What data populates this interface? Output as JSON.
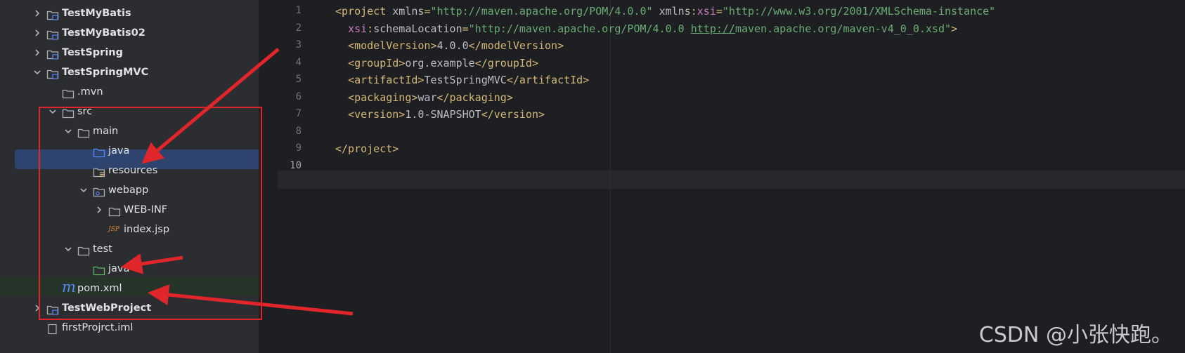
{
  "tree": {
    "items": [
      {
        "label": "TestMyBatis",
        "indent": 0,
        "arrow": "right",
        "icon": "module-folder-icon",
        "bold": true
      },
      {
        "label": "TestMyBatis02",
        "indent": 0,
        "arrow": "right",
        "icon": "module-folder-icon",
        "bold": true
      },
      {
        "label": "TestSpring",
        "indent": 0,
        "arrow": "right",
        "icon": "module-folder-icon",
        "bold": true
      },
      {
        "label": "TestSpringMVC",
        "indent": 0,
        "arrow": "down",
        "icon": "module-folder-icon",
        "bold": true
      },
      {
        "label": ".mvn",
        "indent": 1,
        "arrow": "",
        "icon": "folder-icon",
        "bold": false
      },
      {
        "label": "src",
        "indent": 1,
        "arrow": "down",
        "icon": "folder-icon",
        "bold": false
      },
      {
        "label": "main",
        "indent": 2,
        "arrow": "down",
        "icon": "folder-icon",
        "bold": false
      },
      {
        "label": "java",
        "indent": 3,
        "arrow": "",
        "icon": "source-folder-icon",
        "bold": false
      },
      {
        "label": "resources",
        "indent": 3,
        "arrow": "",
        "icon": "resources-folder-icon",
        "bold": false
      },
      {
        "label": "webapp",
        "indent": 3,
        "arrow": "down",
        "icon": "web-folder-icon",
        "bold": false
      },
      {
        "label": "WEB-INF",
        "indent": 4,
        "arrow": "right",
        "icon": "folder-icon",
        "bold": false
      },
      {
        "label": "index.jsp",
        "indent": 4,
        "arrow": "",
        "icon": "jsp-file-icon",
        "bold": false
      },
      {
        "label": "test",
        "indent": 2,
        "arrow": "down",
        "icon": "folder-icon",
        "bold": false
      },
      {
        "label": "java",
        "indent": 3,
        "arrow": "",
        "icon": "test-folder-icon",
        "bold": false
      },
      {
        "label": "pom.xml",
        "indent": 1,
        "arrow": "",
        "icon": "maven-file-icon",
        "bold": false
      },
      {
        "label": "TestWebProject",
        "indent": 0,
        "arrow": "right",
        "icon": "module-folder-icon",
        "bold": true
      },
      {
        "label": "firstProjrct.iml",
        "indent": 0,
        "arrow": "",
        "icon": "iml-file-icon",
        "bold": false
      }
    ],
    "jsp_badge": "JSP",
    "maven_badge": "m"
  },
  "editor": {
    "line_numbers": [
      "1",
      "2",
      "3",
      "4",
      "5",
      "6",
      "7",
      "8",
      "9",
      "10"
    ],
    "lines": [
      [
        [
          "tag",
          "<project "
        ],
        [
          "attr",
          "xmlns"
        ],
        [
          "tag",
          "="
        ],
        [
          "str",
          "\"http://maven.apache.org/POM/4.0.0\""
        ],
        [
          "attr",
          " xmlns"
        ],
        [
          "tag",
          ":"
        ],
        [
          "ns",
          "xsi"
        ],
        [
          "tag",
          "="
        ],
        [
          "str",
          "\"http://www.w3.org/2001/XMLSchema-instance\""
        ]
      ],
      [
        [
          "attr",
          "  "
        ],
        [
          "ns",
          "xsi"
        ],
        [
          "tag",
          ":"
        ],
        [
          "attr",
          "schemaLocation"
        ],
        [
          "tag",
          "="
        ],
        [
          "str",
          "\"http://maven.apache.org/POM/4.0.0 "
        ],
        [
          "url",
          "http://"
        ],
        [
          "str",
          "maven.apache.org/maven-v4_0_0.xsd\""
        ],
        [
          "tag",
          ">"
        ]
      ],
      [
        [
          "attr",
          "  "
        ],
        [
          "tag",
          "<modelVersion>"
        ],
        [
          "attr",
          "4.0.0"
        ],
        [
          "tag",
          "</modelVersion>"
        ]
      ],
      [
        [
          "attr",
          "  "
        ],
        [
          "tag",
          "<groupId>"
        ],
        [
          "attr",
          "org.example"
        ],
        [
          "tag",
          "</groupId>"
        ]
      ],
      [
        [
          "attr",
          "  "
        ],
        [
          "tag",
          "<artifactId>"
        ],
        [
          "attr",
          "TestSpringMVC"
        ],
        [
          "tag",
          "</artifactId>"
        ]
      ],
      [
        [
          "attr",
          "  "
        ],
        [
          "tag",
          "<packaging>"
        ],
        [
          "attr",
          "war"
        ],
        [
          "tag",
          "</packaging>"
        ]
      ],
      [
        [
          "attr",
          "  "
        ],
        [
          "tag",
          "<version>"
        ],
        [
          "attr",
          "1.0-SNAPSHOT"
        ],
        [
          "tag",
          "</version>"
        ]
      ],
      [],
      [
        [
          "tag",
          "</project>"
        ]
      ],
      []
    ],
    "current_line": "10"
  },
  "watermark": "CSDN @小张快跑。",
  "colors": {
    "tag": "#d5b778",
    "string": "#6aab73",
    "namespace": "#c77dbb",
    "annotation": "#e0262a",
    "selection": "#2e436e"
  }
}
